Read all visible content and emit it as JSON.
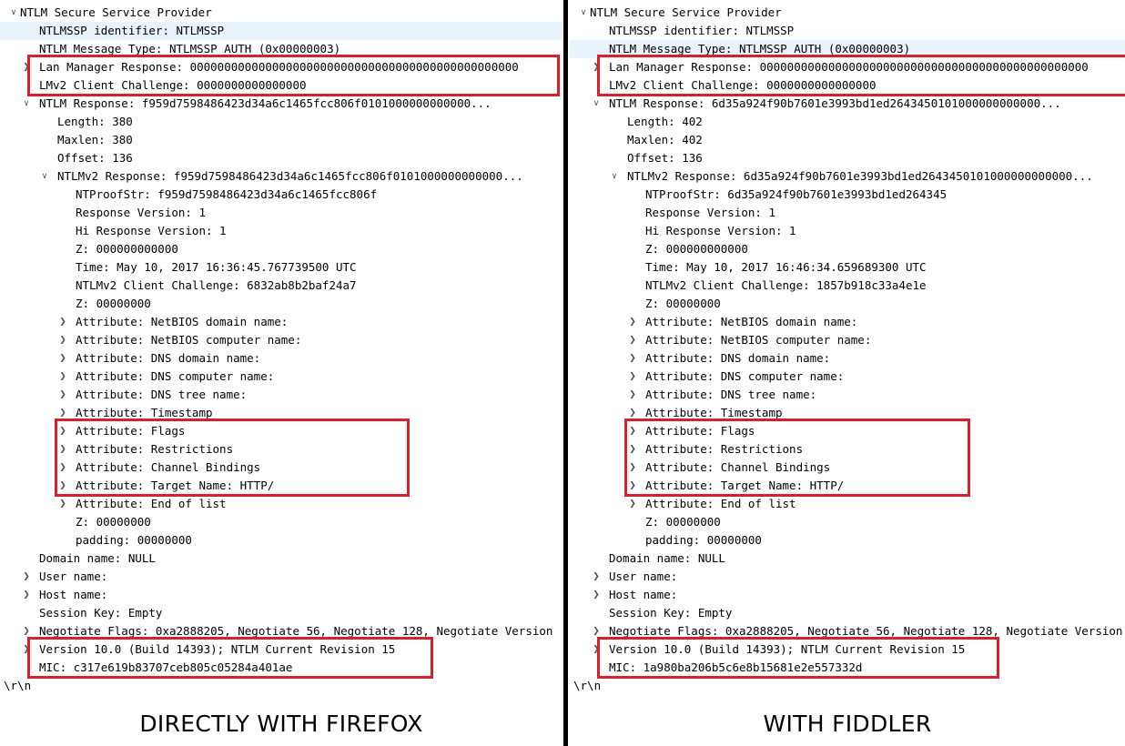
{
  "panels": [
    {
      "caption": "DIRECTLY WITH FIREFOX",
      "rows": [
        {
          "indent": 0,
          "toggle": "expanded",
          "text": "NTLM Secure Service Provider"
        },
        {
          "indent": 2,
          "toggle": "none",
          "text": "NTLMSSP identifier: NTLMSSP",
          "selected": true
        },
        {
          "indent": 2,
          "toggle": "none",
          "text": "NTLM Message Type: NTLMSSP_AUTH (0x00000003)"
        },
        {
          "indent": 2,
          "toggle": "collapsed",
          "text": "Lan Manager Response: 000000000000000000000000000000000000000000000000"
        },
        {
          "indent": 2,
          "toggle": "none",
          "text": "LMv2 Client Challenge: 0000000000000000"
        },
        {
          "indent": 2,
          "toggle": "expanded",
          "text": "NTLM Response: f959d7598486423d34a6c1465fcc806f0101000000000000..."
        },
        {
          "indent": 3,
          "toggle": "none",
          "text": "Length: 380"
        },
        {
          "indent": 3,
          "toggle": "none",
          "text": "Maxlen: 380"
        },
        {
          "indent": 3,
          "toggle": "none",
          "text": "Offset: 136"
        },
        {
          "indent": 3,
          "toggle": "expanded",
          "text": "NTLMv2 Response: f959d7598486423d34a6c1465fcc806f0101000000000000..."
        },
        {
          "indent": 4,
          "toggle": "none",
          "text": "NTProofStr: f959d7598486423d34a6c1465fcc806f"
        },
        {
          "indent": 4,
          "toggle": "none",
          "text": "Response Version: 1"
        },
        {
          "indent": 4,
          "toggle": "none",
          "text": "Hi Response Version: 1"
        },
        {
          "indent": 4,
          "toggle": "none",
          "text": "Z: 000000000000"
        },
        {
          "indent": 4,
          "toggle": "none",
          "text": "Time: May 10, 2017 16:36:45.767739500 UTC"
        },
        {
          "indent": 4,
          "toggle": "none",
          "text": "NTLMv2 Client Challenge: 6832ab8b2baf24a7"
        },
        {
          "indent": 4,
          "toggle": "none",
          "text": "Z: 00000000"
        },
        {
          "indent": 4,
          "toggle": "collapsed",
          "text": "Attribute: NetBIOS domain name:"
        },
        {
          "indent": 4,
          "toggle": "collapsed",
          "text": "Attribute: NetBIOS computer name:"
        },
        {
          "indent": 4,
          "toggle": "collapsed",
          "text": "Attribute: DNS domain name:"
        },
        {
          "indent": 4,
          "toggle": "collapsed",
          "text": "Attribute: DNS computer name:"
        },
        {
          "indent": 4,
          "toggle": "collapsed",
          "text": "Attribute: DNS tree name:"
        },
        {
          "indent": 4,
          "toggle": "collapsed",
          "text": "Attribute: Timestamp"
        },
        {
          "indent": 4,
          "toggle": "collapsed",
          "text": "Attribute: Flags"
        },
        {
          "indent": 4,
          "toggle": "collapsed",
          "text": "Attribute: Restrictions"
        },
        {
          "indent": 4,
          "toggle": "collapsed",
          "text": "Attribute: Channel Bindings"
        },
        {
          "indent": 4,
          "toggle": "collapsed",
          "text": "Attribute: Target Name: HTTP/"
        },
        {
          "indent": 4,
          "toggle": "collapsed",
          "text": "Attribute: End of list"
        },
        {
          "indent": 4,
          "toggle": "none",
          "text": "Z: 00000000"
        },
        {
          "indent": 4,
          "toggle": "none",
          "text": "padding: 00000000"
        },
        {
          "indent": 2,
          "toggle": "none",
          "text": "Domain name: NULL"
        },
        {
          "indent": 2,
          "toggle": "collapsed",
          "text": "User name:"
        },
        {
          "indent": 2,
          "toggle": "collapsed",
          "text": "Host name:"
        },
        {
          "indent": 2,
          "toggle": "none",
          "text": "Session Key: Empty"
        },
        {
          "indent": 2,
          "toggle": "collapsed",
          "text": "Negotiate Flags: 0xa2888205, Negotiate 56, Negotiate 128, Negotiate Version"
        },
        {
          "indent": 2,
          "toggle": "collapsed",
          "text": "Version 10.0 (Build 14393); NTLM Current Revision 15"
        },
        {
          "indent": 2,
          "toggle": "none",
          "text": "MIC: c317e619b83707ceb805c05284a401ae"
        },
        {
          "indent": 0,
          "toggle": "none",
          "text": "\\r\\n"
        }
      ]
    },
    {
      "caption": "WITH FIDDLER",
      "rows": [
        {
          "indent": 0,
          "toggle": "expanded",
          "text": "NTLM Secure Service Provider"
        },
        {
          "indent": 2,
          "toggle": "none",
          "text": "NTLMSSP identifier: NTLMSSP"
        },
        {
          "indent": 2,
          "toggle": "none",
          "text": "NTLM Message Type: NTLMSSP_AUTH (0x00000003)",
          "selected": true
        },
        {
          "indent": 2,
          "toggle": "collapsed",
          "text": "Lan Manager Response: 000000000000000000000000000000000000000000000000"
        },
        {
          "indent": 2,
          "toggle": "none",
          "text": "LMv2 Client Challenge: 0000000000000000"
        },
        {
          "indent": 2,
          "toggle": "expanded",
          "text": "NTLM Response: 6d35a924f90b7601e3993bd1ed2643450101000000000000..."
        },
        {
          "indent": 3,
          "toggle": "none",
          "text": "Length: 402"
        },
        {
          "indent": 3,
          "toggle": "none",
          "text": "Maxlen: 402"
        },
        {
          "indent": 3,
          "toggle": "none",
          "text": "Offset: 136"
        },
        {
          "indent": 3,
          "toggle": "expanded",
          "text": "NTLMv2 Response: 6d35a924f90b7601e3993bd1ed2643450101000000000000..."
        },
        {
          "indent": 4,
          "toggle": "none",
          "text": "NTProofStr: 6d35a924f90b7601e3993bd1ed264345"
        },
        {
          "indent": 4,
          "toggle": "none",
          "text": "Response Version: 1"
        },
        {
          "indent": 4,
          "toggle": "none",
          "text": "Hi Response Version: 1"
        },
        {
          "indent": 4,
          "toggle": "none",
          "text": "Z: 000000000000"
        },
        {
          "indent": 4,
          "toggle": "none",
          "text": "Time: May 10, 2017 16:46:34.659689300 UTC"
        },
        {
          "indent": 4,
          "toggle": "none",
          "text": "NTLMv2 Client Challenge: 1857b918c33a4e1e"
        },
        {
          "indent": 4,
          "toggle": "none",
          "text": "Z: 00000000"
        },
        {
          "indent": 4,
          "toggle": "collapsed",
          "text": "Attribute: NetBIOS domain name:"
        },
        {
          "indent": 4,
          "toggle": "collapsed",
          "text": "Attribute: NetBIOS computer name:"
        },
        {
          "indent": 4,
          "toggle": "collapsed",
          "text": "Attribute: DNS domain name:"
        },
        {
          "indent": 4,
          "toggle": "collapsed",
          "text": "Attribute: DNS computer name:"
        },
        {
          "indent": 4,
          "toggle": "collapsed",
          "text": "Attribute: DNS tree name:"
        },
        {
          "indent": 4,
          "toggle": "collapsed",
          "text": "Attribute: Timestamp"
        },
        {
          "indent": 4,
          "toggle": "collapsed",
          "text": "Attribute: Flags"
        },
        {
          "indent": 4,
          "toggle": "collapsed",
          "text": "Attribute: Restrictions"
        },
        {
          "indent": 4,
          "toggle": "collapsed",
          "text": "Attribute: Channel Bindings"
        },
        {
          "indent": 4,
          "toggle": "collapsed",
          "text": "Attribute: Target Name: HTTP/"
        },
        {
          "indent": 4,
          "toggle": "collapsed",
          "text": "Attribute: End of list"
        },
        {
          "indent": 4,
          "toggle": "none",
          "text": "Z: 00000000"
        },
        {
          "indent": 4,
          "toggle": "none",
          "text": "padding: 00000000"
        },
        {
          "indent": 2,
          "toggle": "none",
          "text": "Domain name: NULL"
        },
        {
          "indent": 2,
          "toggle": "collapsed",
          "text": "User name:"
        },
        {
          "indent": 2,
          "toggle": "collapsed",
          "text": "Host name:"
        },
        {
          "indent": 2,
          "toggle": "none",
          "text": "Session Key: Empty"
        },
        {
          "indent": 2,
          "toggle": "collapsed",
          "text": "Negotiate Flags: 0xa2888205, Negotiate 56, Negotiate 128, Negotiate Version"
        },
        {
          "indent": 2,
          "toggle": "collapsed",
          "text": "Version 10.0 (Build 14393); NTLM Current Revision 15"
        },
        {
          "indent": 2,
          "toggle": "none",
          "text": "MIC: 1a980ba206b5c6e8b15681e2e557332d"
        },
        {
          "indent": 0,
          "toggle": "none",
          "text": "\\r\\n"
        }
      ]
    }
  ],
  "highlight_rows": [
    [
      3,
      4
    ],
    [
      23,
      26
    ],
    [
      35,
      36
    ]
  ],
  "colors": {
    "highlight_border": "#d6202a",
    "selected_row": "#e9f3fc",
    "divider": "#000000"
  },
  "glyphs": {
    "expanded": "∨",
    "collapsed": "❯"
  }
}
